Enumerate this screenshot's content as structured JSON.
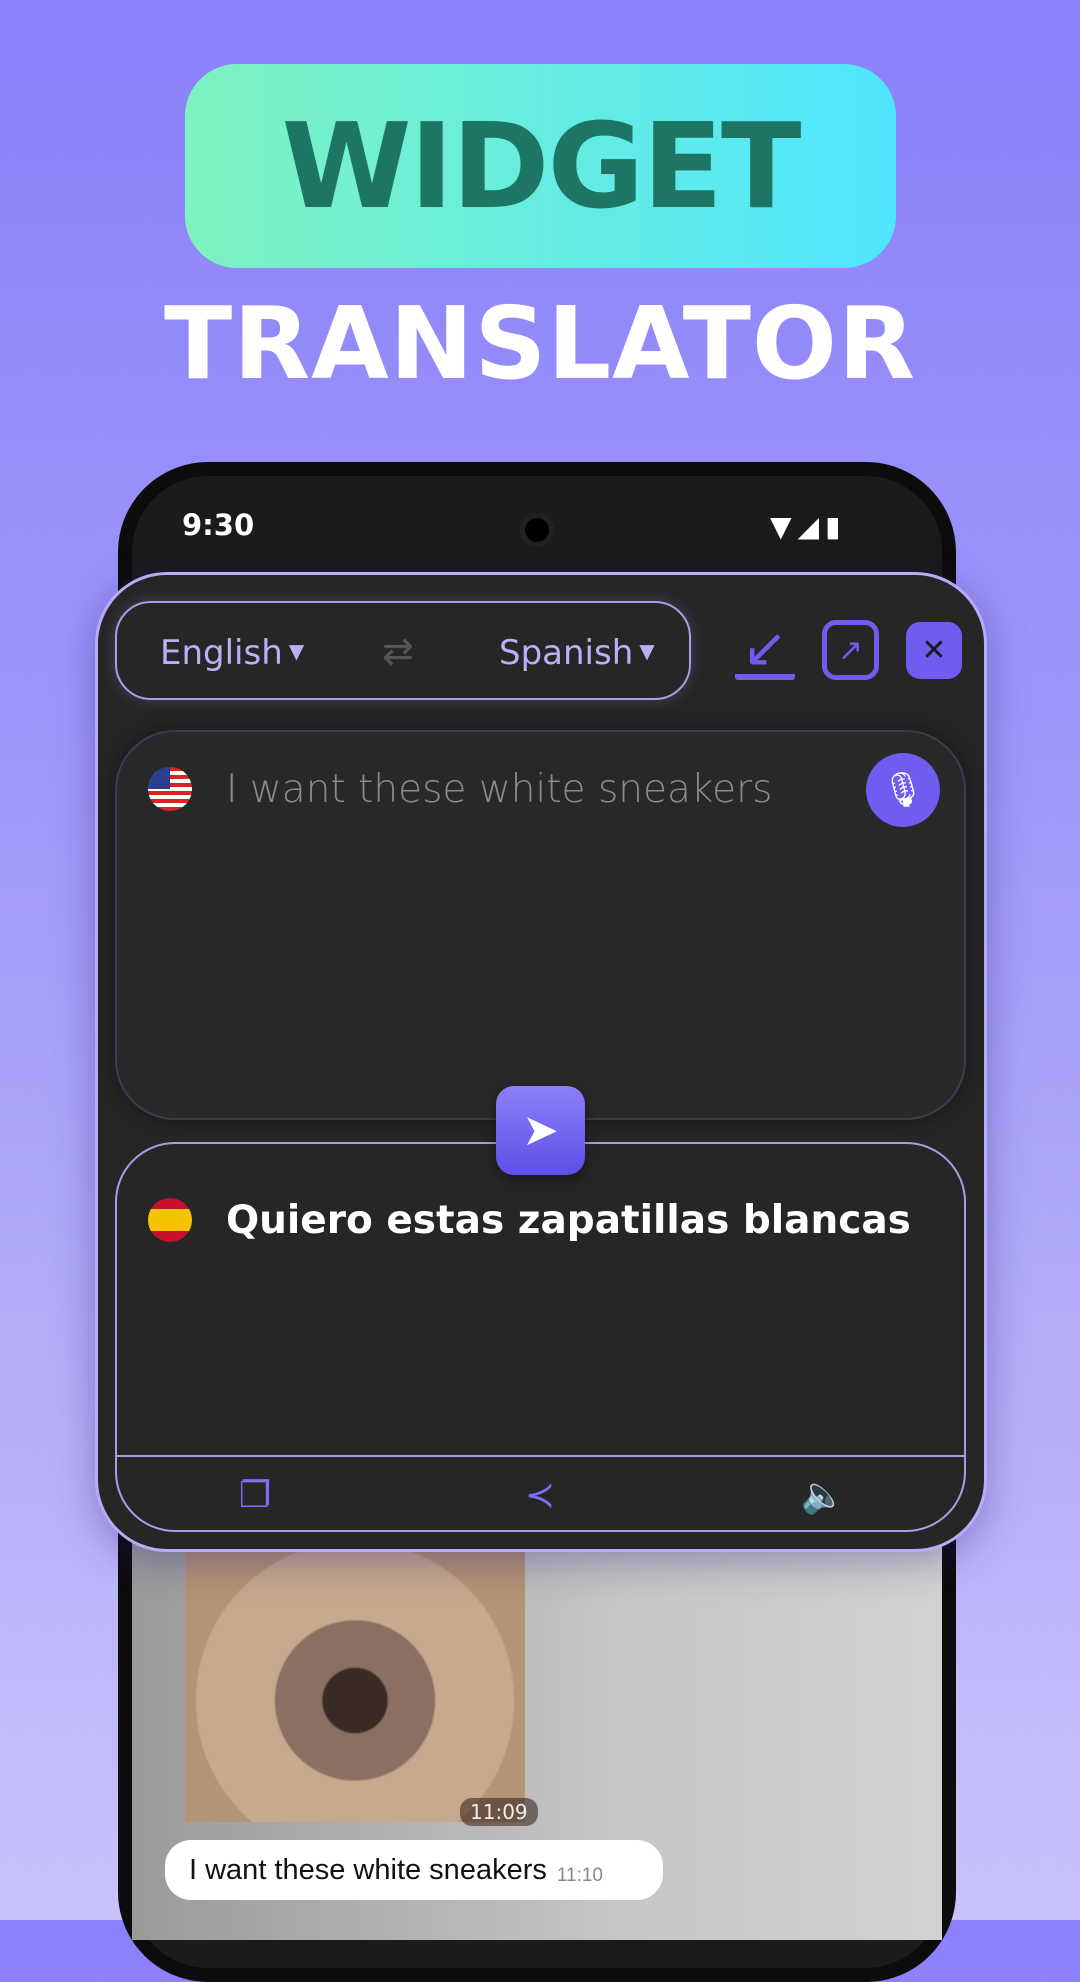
{
  "promo": {
    "badge": "WIDGET",
    "subtitle": "TRANSLATOR"
  },
  "status_bar": {
    "time": "9:30",
    "icons": [
      "wifi-icon",
      "signal-icon",
      "battery-icon"
    ]
  },
  "widget": {
    "source_language": "English",
    "target_language": "Spanish",
    "input_text": "I want these white sneakers",
    "output_text": "Quiero estas zapatillas blancas",
    "accent": "#6e5df0"
  },
  "chat": {
    "image_time": "11:09",
    "message": "I want these white sneakers",
    "message_time": "11:10"
  }
}
